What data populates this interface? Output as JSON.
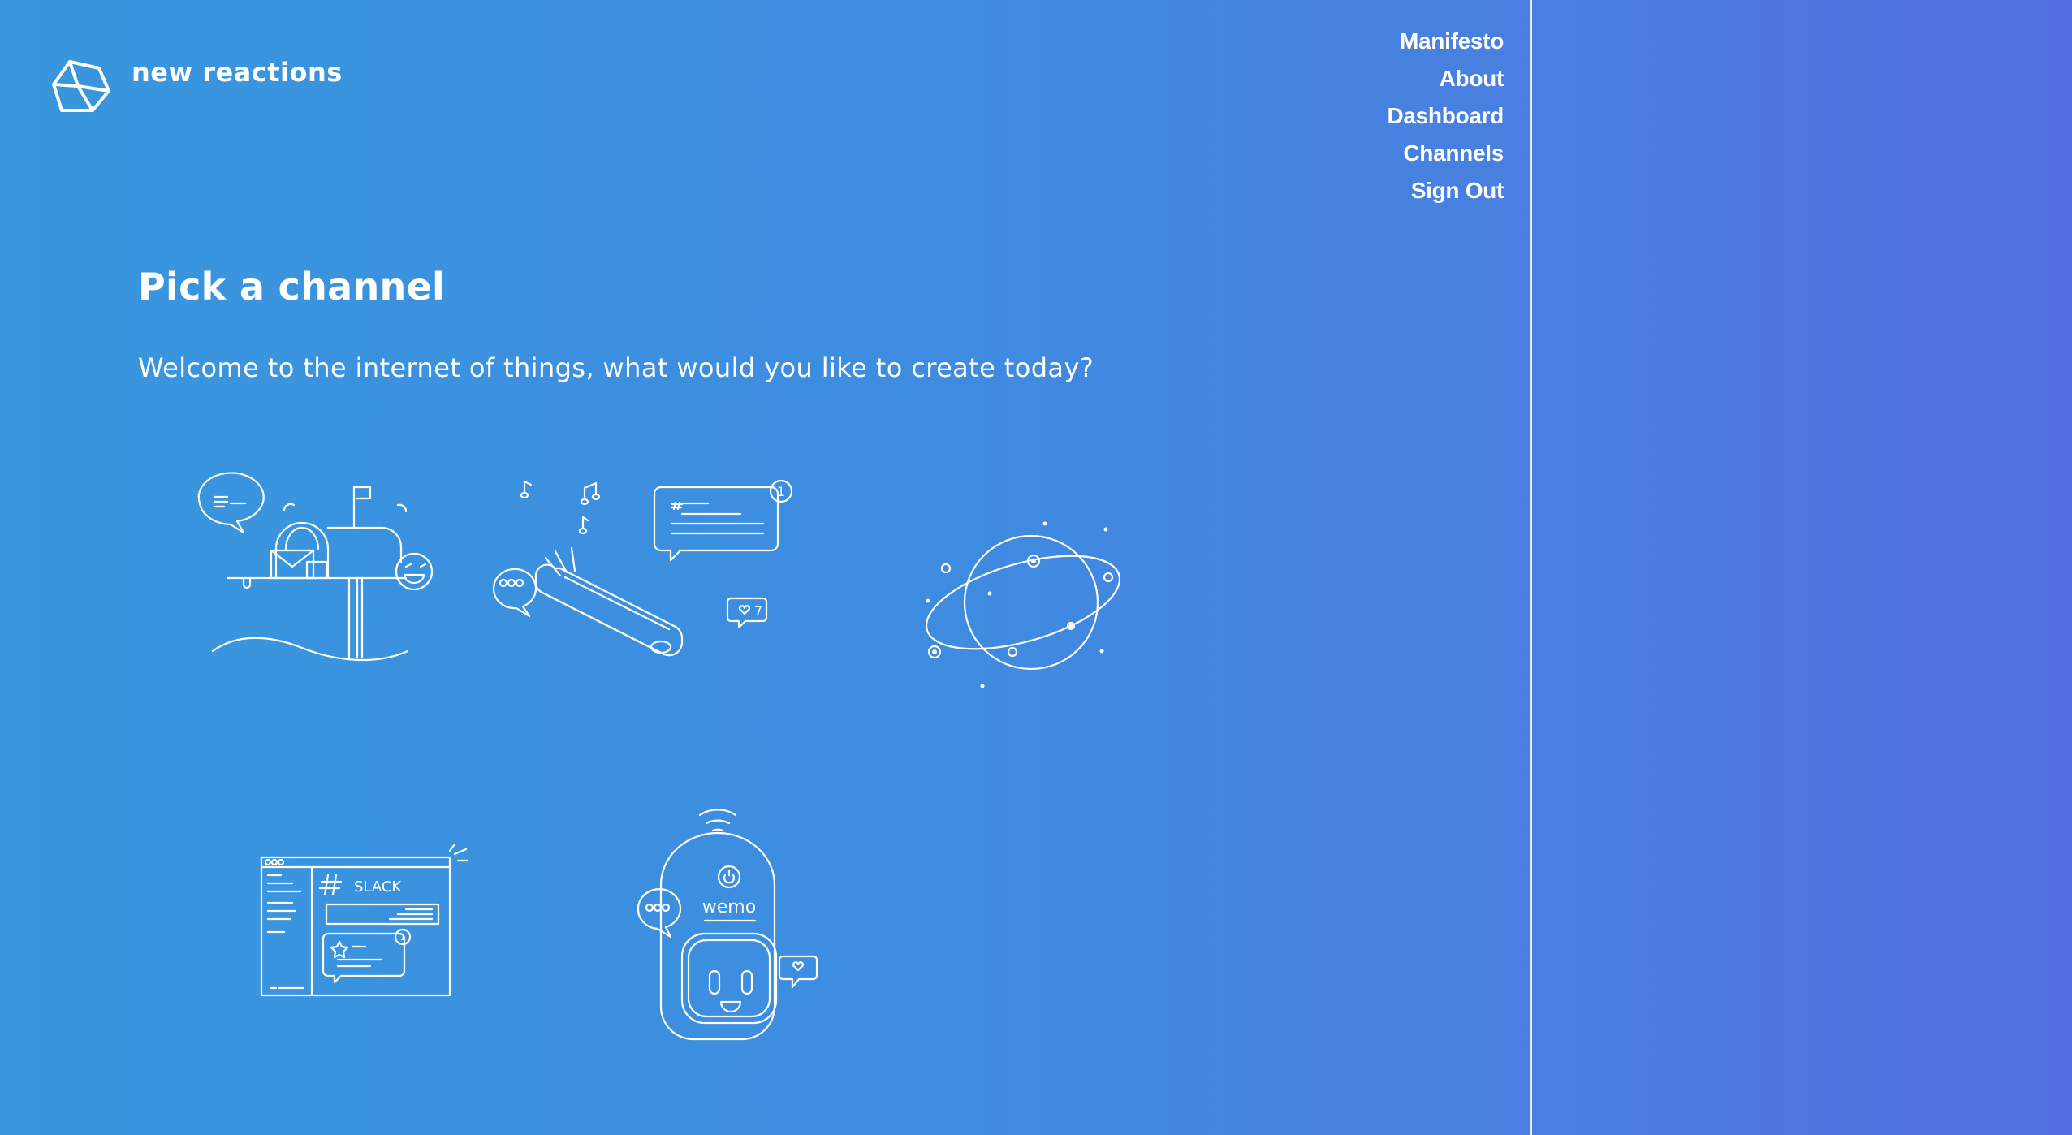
{
  "brand": {
    "name": "new reactions"
  },
  "nav": {
    "manifesto": "Manifesto",
    "about": "About",
    "dashboard": "Dashboard",
    "channels": "Channels",
    "sign_out": "Sign Out"
  },
  "main": {
    "title": "Pick a channel",
    "subtitle": "Welcome to the internet of things, what would you like to create today?"
  },
  "channels": {
    "sms": {
      "notification_count": "1",
      "like_count": "7"
    },
    "slack": {
      "label": "SLACK",
      "notification_count": "1"
    },
    "wemo": {
      "label": "wemo"
    }
  },
  "colors": {
    "gradient_start": "#3897dd",
    "gradient_end": "#5470e0",
    "foreground": "#ffffff"
  }
}
